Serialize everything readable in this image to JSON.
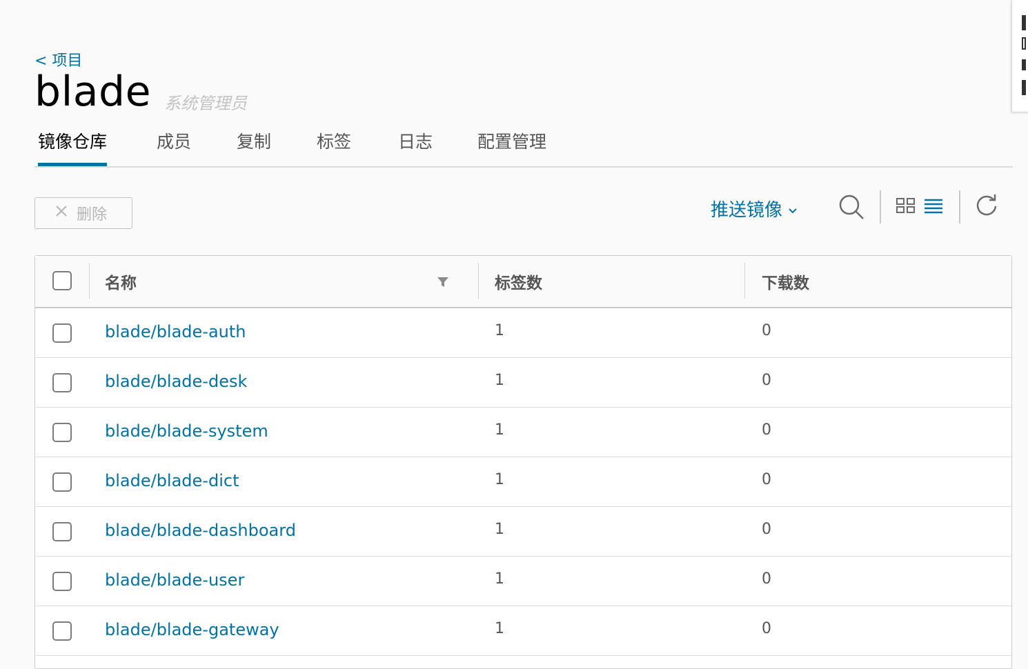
{
  "breadcrumb": {
    "back_label": "< 项目"
  },
  "project": {
    "name": "blade",
    "role": "系统管理员"
  },
  "tabs": [
    {
      "label": "镜像仓库"
    },
    {
      "label": "成员"
    },
    {
      "label": "复制"
    },
    {
      "label": "标签"
    },
    {
      "label": "日志"
    },
    {
      "label": "配置管理"
    }
  ],
  "toolbar": {
    "delete_label": "删除",
    "push_label": "推送镜像"
  },
  "table": {
    "headers": {
      "name": "名称",
      "tags": "标签数",
      "pulls": "下载数"
    },
    "rows": [
      {
        "name": "blade/blade-auth",
        "tags": "1",
        "pulls": "0"
      },
      {
        "name": "blade/blade-desk",
        "tags": "1",
        "pulls": "0"
      },
      {
        "name": "blade/blade-system",
        "tags": "1",
        "pulls": "0"
      },
      {
        "name": "blade/blade-dict",
        "tags": "1",
        "pulls": "0"
      },
      {
        "name": "blade/blade-dashboard",
        "tags": "1",
        "pulls": "0"
      },
      {
        "name": "blade/blade-user",
        "tags": "1",
        "pulls": "0"
      },
      {
        "name": "blade/blade-gateway",
        "tags": "1",
        "pulls": "0"
      }
    ]
  },
  "colors": {
    "accent": "#0072a3",
    "muted": "#c3c3c3"
  }
}
